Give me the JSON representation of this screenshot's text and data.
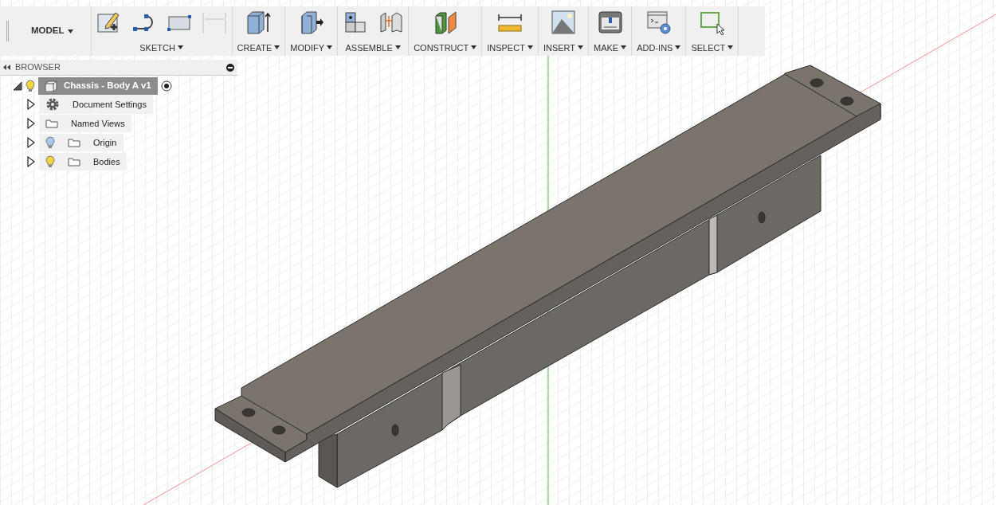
{
  "toolbar": {
    "workspace": {
      "label": "MODEL"
    },
    "groups": [
      {
        "label": "SKETCH",
        "icons": [
          {
            "kind": "sketch",
            "disabled": false
          },
          {
            "kind": "arc",
            "disabled": false
          },
          {
            "kind": "rectangle",
            "disabled": false
          },
          {
            "kind": "dimension",
            "disabled": true
          }
        ]
      },
      {
        "label": "CREATE",
        "icons": [
          {
            "kind": "extrude",
            "disabled": false
          }
        ]
      },
      {
        "label": "MODIFY",
        "icons": [
          {
            "kind": "pushpull",
            "disabled": false
          }
        ]
      },
      {
        "label": "ASSEMBLE",
        "icons": [
          {
            "kind": "component",
            "disabled": false
          },
          {
            "kind": "joint",
            "disabled": false
          }
        ]
      },
      {
        "label": "CONSTRUCT",
        "icons": [
          {
            "kind": "plane",
            "disabled": false
          }
        ]
      },
      {
        "label": "INSPECT",
        "icons": [
          {
            "kind": "measure",
            "disabled": false
          }
        ]
      },
      {
        "label": "INSERT",
        "icons": [
          {
            "kind": "image",
            "disabled": false
          }
        ]
      },
      {
        "label": "MAKE",
        "icons": [
          {
            "kind": "printer",
            "disabled": false
          }
        ]
      },
      {
        "label": "ADD-INS",
        "icons": [
          {
            "kind": "script",
            "disabled": false
          }
        ]
      },
      {
        "label": "SELECT",
        "icons": [
          {
            "kind": "select",
            "disabled": false
          }
        ]
      }
    ]
  },
  "browser": {
    "title": "BROWSER",
    "root": {
      "label": "Chassis - Body A v1",
      "visible": true,
      "expanded": true,
      "active": true
    },
    "items": [
      {
        "label": "Document Settings",
        "kind": "settings",
        "expanded": false
      },
      {
        "label": "Named Views",
        "kind": "folder",
        "expanded": false
      },
      {
        "label": "Origin",
        "kind": "folder",
        "expanded": false,
        "visible": false
      },
      {
        "label": "Bodies",
        "kind": "folder",
        "expanded": false,
        "visible": true
      }
    ]
  }
}
